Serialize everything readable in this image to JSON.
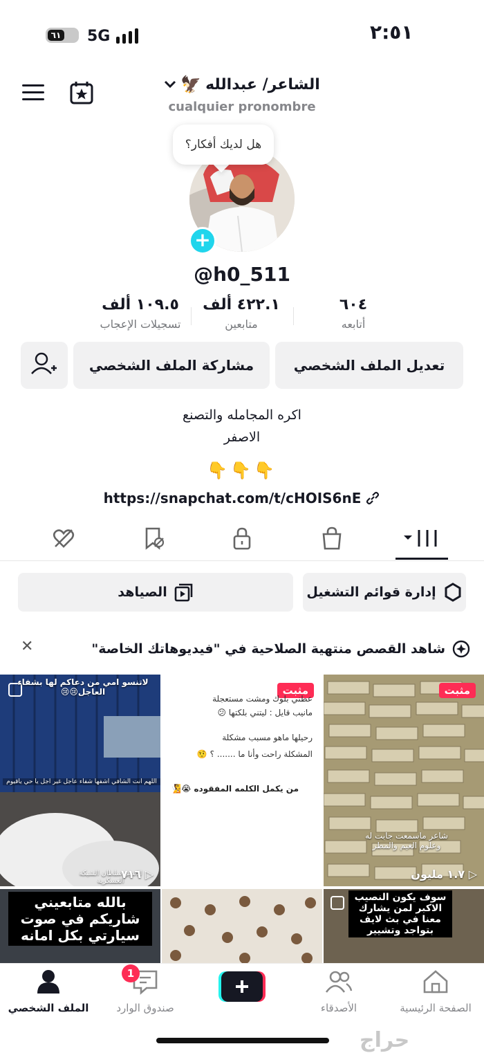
{
  "status_bar": {
    "time": "٢:٥١",
    "network": "5G",
    "battery_level": "٦١"
  },
  "header": {
    "display_name": "الشاعر/ عبدالله",
    "emoji": "🦅",
    "pronoun": "cualquier pronombre"
  },
  "avatar": {
    "bubble_text": "هل لديك أفكار؟"
  },
  "profile": {
    "username": "@h0_511"
  },
  "stats": [
    {
      "value": "٦٠٤",
      "label": "أتابعه"
    },
    {
      "value": "٤٢٢.١ ألف",
      "label": "متابعين"
    },
    {
      "value": "١٠٩.٥ ألف",
      "label": "تسجيلات الإعجاب"
    }
  ],
  "buttons": {
    "edit": "تعديل الملف الشخصي",
    "share": "مشاركة الملف الشخصي"
  },
  "bio": {
    "line1": "اكره المجامله والتصنع",
    "line2": "الاصفر",
    "emojis": "👇👇👇",
    "link": "https://snapchat.com/t/cHOIS6nE"
  },
  "pills": {
    "playlists": "إدارة قوائم التشغيل",
    "collection": "الصياهد"
  },
  "notice": {
    "text": "شاهد القصص منتهية الصلاحية في \"فيديوهاتك الخاصة\""
  },
  "grid": {
    "pinned_label": "مثبت",
    "videos": [
      {
        "views": "١.٧ مليون",
        "overlay": "شاعر ماسمعت جابت له وعلوم الغيم والمطر"
      },
      {
        "lines": [
          "عطني بلوك ومشت مستعجلة",
          "مانيب قايل : ليتني بلكتها 😕",
          "رحيلها ماهو مسبب مشكلة",
          "المشكلة راحت وأنا ما ....... ؟ 🤨",
          "من يكمل الكلمه المفقوده 😭🧏"
        ]
      },
      {
        "views": "٧١٦",
        "overlay_top": "لاتنسو امي من دعاكم لها بشفاء العاجل😢😢",
        "overlay_mid": "اللهم انت الشافي اشفها شفاء عاجل غير اجل يا حي ياقيوم",
        "overlay_bottom": "الاسير سلطان الشبكة العسكرية"
      },
      {
        "caption": "سوف يكون النصيب الاكبر لمن يشارك معنا في بث لايف بتواجد وتشيير"
      },
      {
        "caption": ""
      },
      {
        "caption": "بالله متابعيني شاريكم في صوت سيارتي بكل امانه"
      }
    ]
  },
  "nav": {
    "home": "الصفحة الرئيسية",
    "friends": "الأصدقاء",
    "inbox": "صندوق الوارد",
    "inbox_badge": "1",
    "profile": "الملف الشخصي"
  },
  "watermark": "حراج",
  "colors": {
    "accent": "#fe2c55",
    "cyan": "#20d5ec",
    "pill_bg": "#f1f1f2"
  }
}
